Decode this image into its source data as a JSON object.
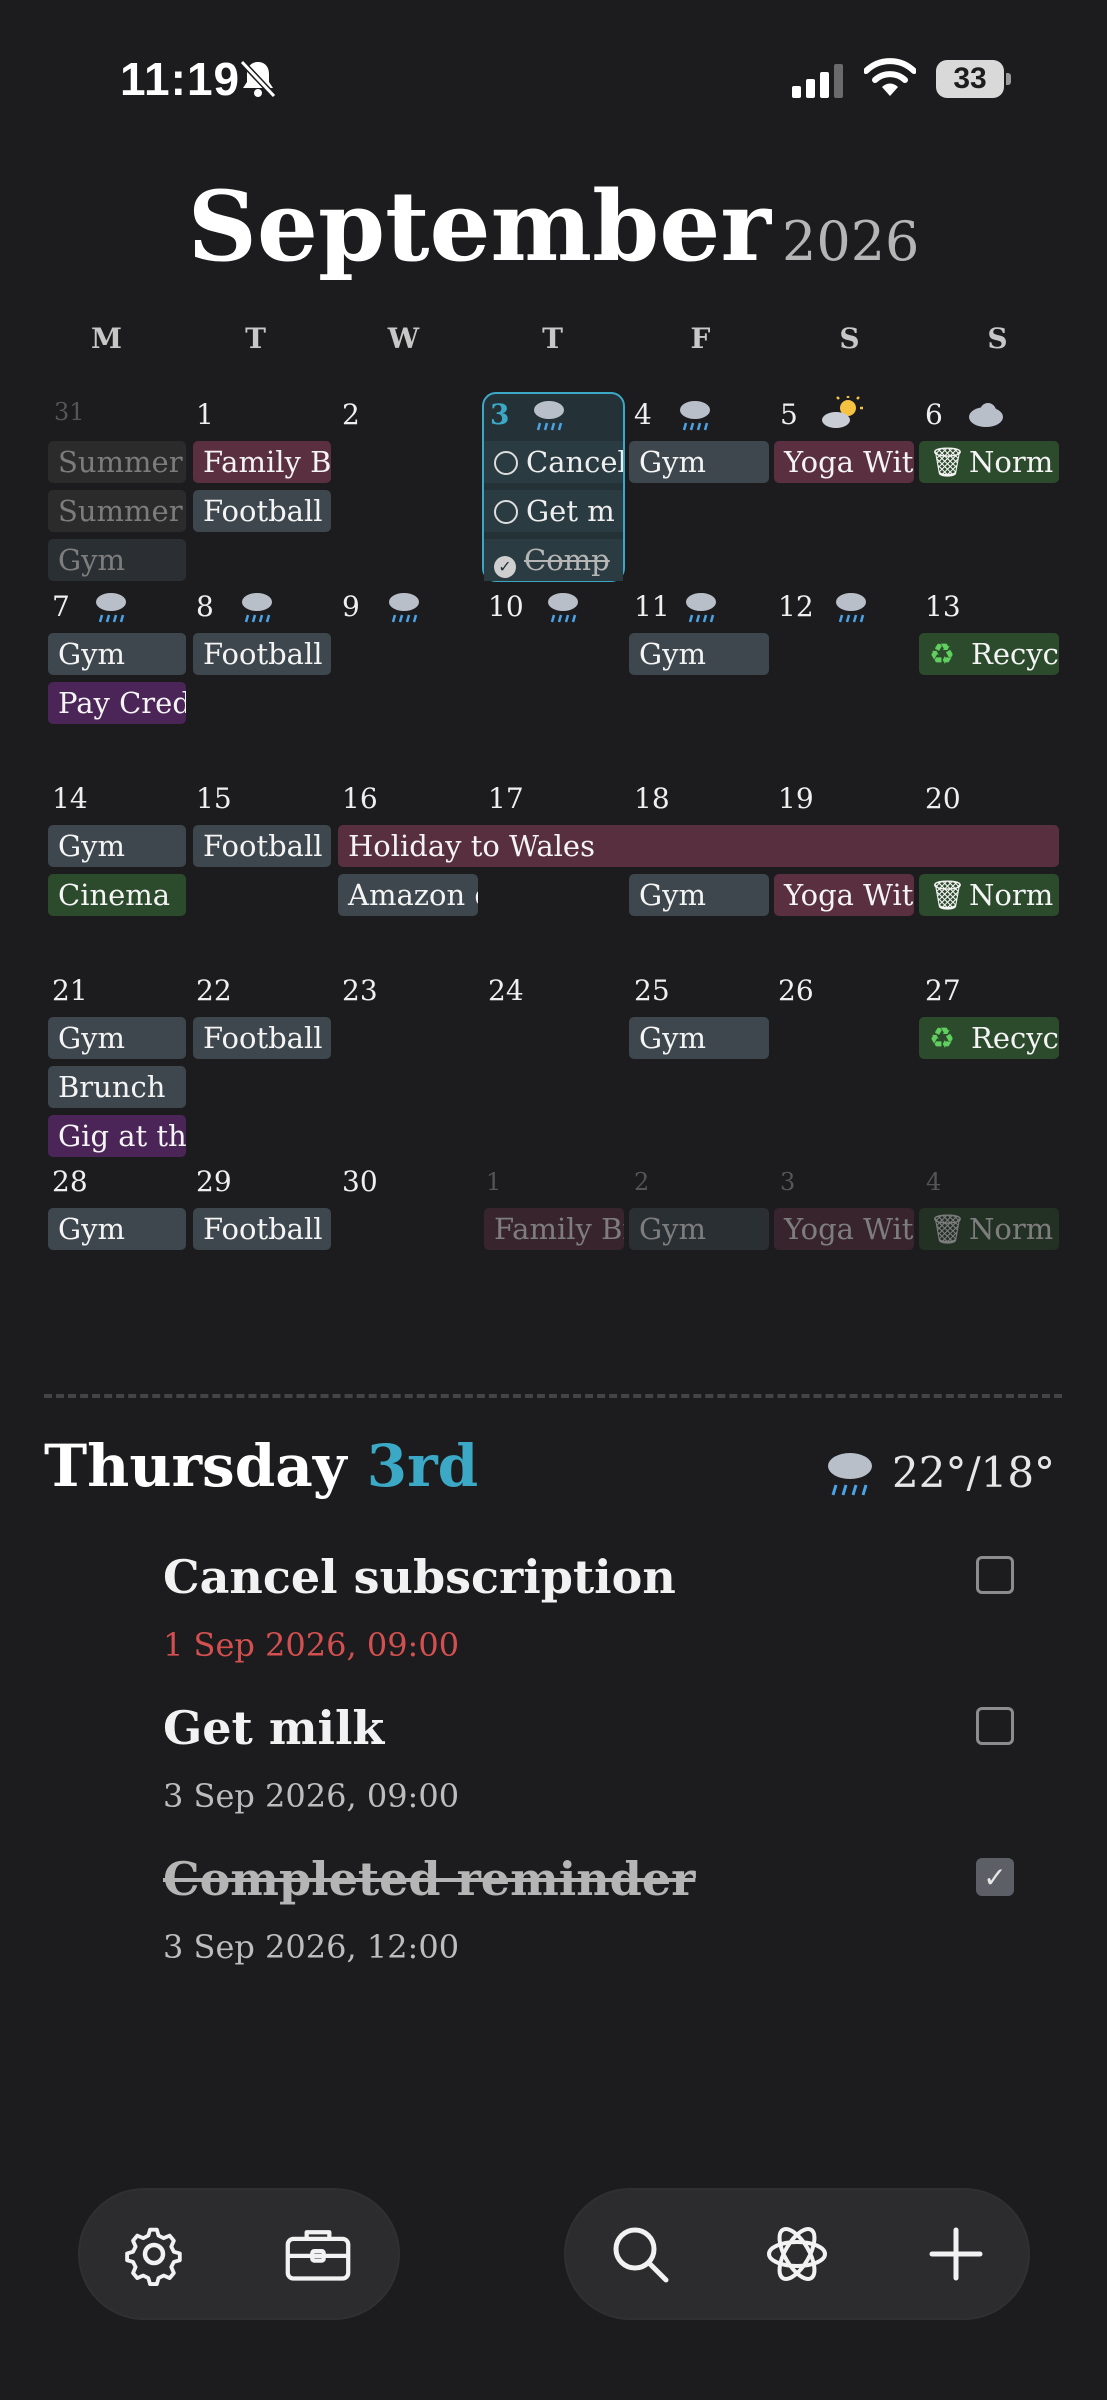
{
  "status_bar": {
    "time": "11:19",
    "battery": "33"
  },
  "header": {
    "month": "September",
    "year": "2026"
  },
  "weekdays": [
    "M",
    "T",
    "W",
    "T",
    "F",
    "S",
    "S"
  ],
  "weeks": [
    {
      "days": [
        "31",
        "1",
        "2",
        "3",
        "4",
        "5",
        "6"
      ]
    },
    {
      "days": [
        "7",
        "8",
        "9",
        "10",
        "11",
        "12",
        "13"
      ]
    },
    {
      "days": [
        "14",
        "15",
        "16",
        "17",
        "18",
        "19",
        "20"
      ]
    },
    {
      "days": [
        "21",
        "22",
        "23",
        "24",
        "25",
        "26",
        "27"
      ]
    },
    {
      "days": [
        "28",
        "29",
        "30",
        "1",
        "2",
        "3",
        "4"
      ]
    }
  ],
  "events": {
    "summer": "Summer",
    "gym": "Gym",
    "family": "Family Br",
    "football": "Football T",
    "yoga": "Yoga With",
    "normal": "Norm",
    "recycling": "Recyc",
    "pay_credit": "Pay Cred",
    "cinema": "Cinema",
    "holiday": "Holiday to Wales",
    "amazon": "Amazon d",
    "brunch": "Brunch",
    "gig": "Gig at the"
  },
  "today_reminders": {
    "r1": "Cancel",
    "r2": "Get m",
    "r3": "Comp"
  },
  "selected_day": {
    "weekday": "Thursday",
    "date": "3rd",
    "temps": "22°/18°"
  },
  "tasks": [
    {
      "title": "Cancel subscription",
      "date": "1 Sep 2026, 09:00",
      "completed": false,
      "overdue": true
    },
    {
      "title": "Get milk",
      "date": "3 Sep 2026, 09:00",
      "completed": false,
      "overdue": false
    },
    {
      "title": "Completed reminder",
      "date": "3 Sep 2026, 12:00",
      "completed": true,
      "overdue": false
    }
  ],
  "icons": {
    "weather_rain": "rain-cloud-icon",
    "weather_sun": "sun-cloud-icon",
    "weather_cloud": "cloud-icon",
    "normal_bin": "trash-bin-icon",
    "recycling": "recycling-icon",
    "toolbar": [
      "gear-icon",
      "briefcase-icon",
      "search-icon",
      "atom-icon",
      "plus-icon"
    ]
  },
  "colors": {
    "accent": "#3ba9c6",
    "overdue": "#d45050",
    "background": "#1c1c1e"
  }
}
